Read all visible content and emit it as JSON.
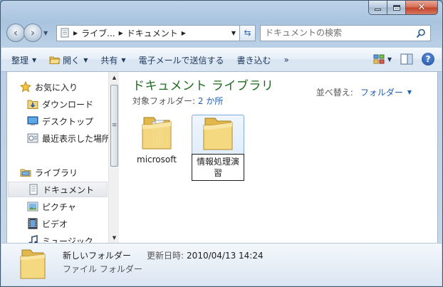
{
  "window": {
    "caption_buttons": {
      "minimize": "minimize",
      "maximize": "maximize",
      "close": "✕"
    }
  },
  "address_bar": {
    "crumbs": [
      "ライブ...",
      "ドキュメント"
    ],
    "search_placeholder": "ドキュメントの検索"
  },
  "toolbar": {
    "organize": "整理",
    "open": "開く",
    "share": "共有",
    "email": "電子メールで送信する",
    "burn": "書き込む",
    "more": "»",
    "help": "?"
  },
  "nav_pane": {
    "favorites": "お気に入り",
    "downloads": "ダウンロード",
    "desktop": "デスクトップ",
    "recent": "最近表示した場所",
    "libraries": "ライブラリ",
    "documents": "ドキュメント",
    "pictures": "ピクチャ",
    "videos": "ビデオ",
    "music": "ミュージック"
  },
  "content": {
    "title": "ドキュメント ライブラリ",
    "includes_label": "対象フォルダー:",
    "includes_value": "2 か所",
    "arrange_label": "並べ替え:",
    "arrange_value": "フォルダー",
    "files": [
      {
        "name": "microsoft"
      },
      {
        "name": "情報処理演習"
      }
    ]
  },
  "details": {
    "name": "新しいフォルダー",
    "modified_label": "更新日時:",
    "modified_value": "2010/04/13 14:24",
    "type": "ファイル フォルダー"
  },
  "colors": {
    "library_title": "#1e6b1e",
    "link": "#1e5fb3",
    "folder": "#f2d47a"
  }
}
